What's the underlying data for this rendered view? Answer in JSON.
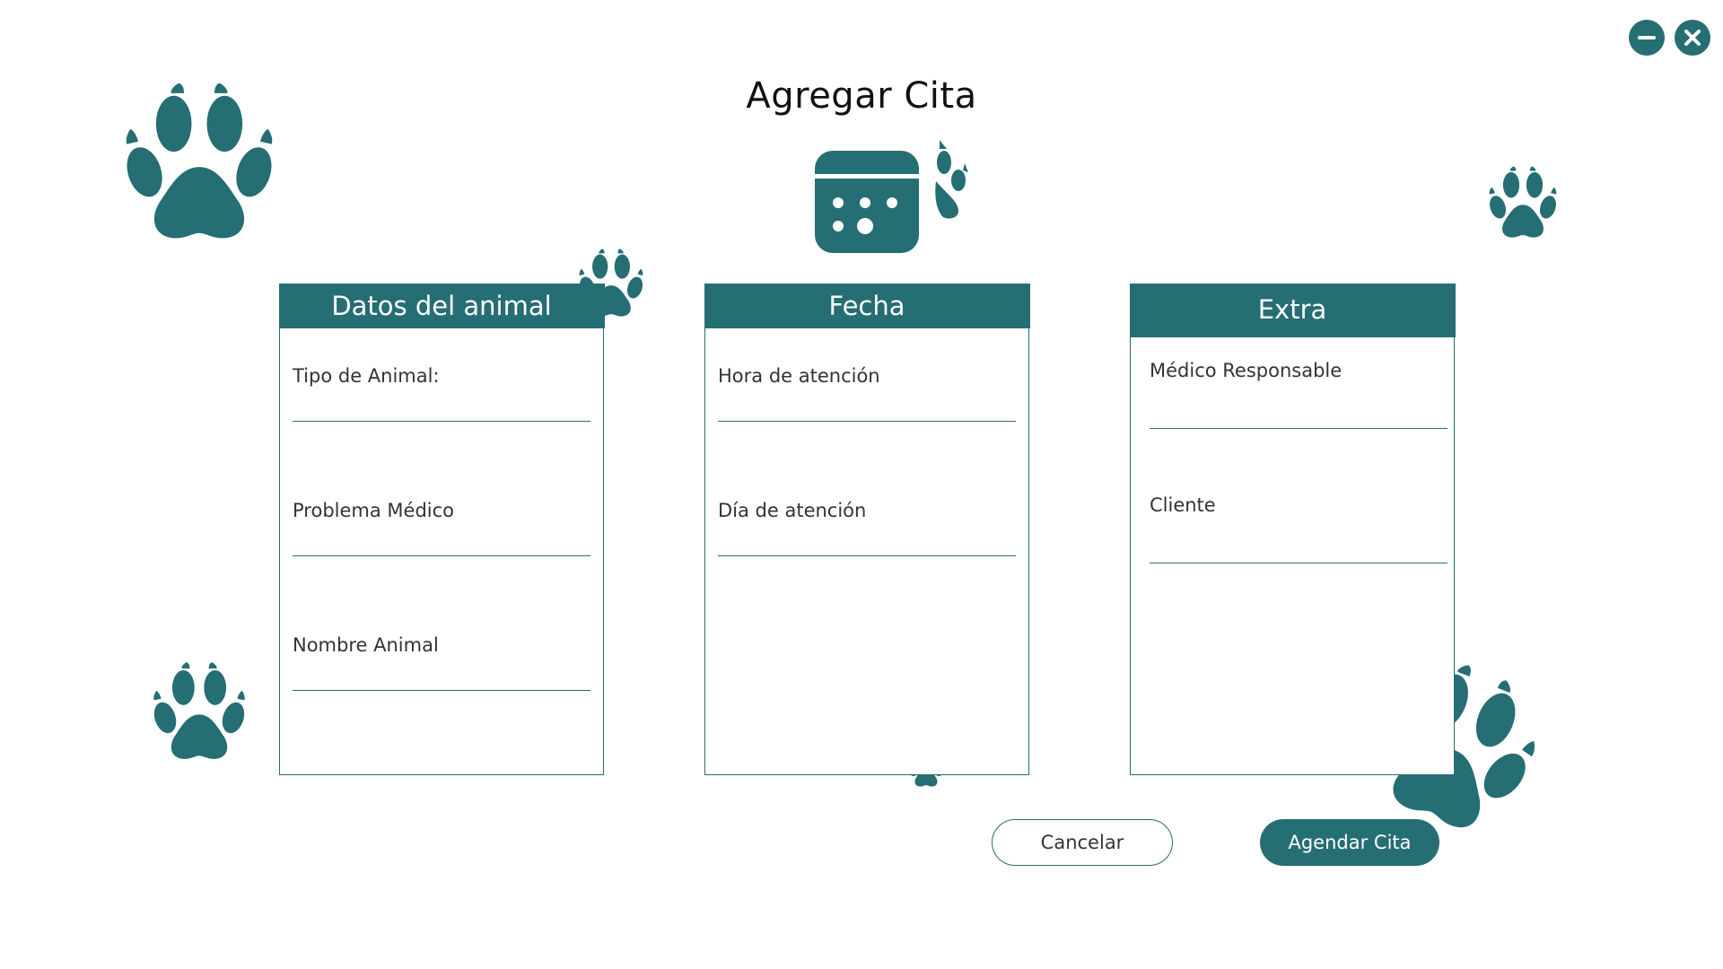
{
  "window": {
    "minimize_icon": "minus-icon",
    "close_icon": "close-x-icon"
  },
  "title": "Agregar Cita",
  "header_icon": "calendar-paw-icon",
  "decorations": {
    "icon": "paw-print-icon",
    "color": "#256e74"
  },
  "panels": {
    "animal": {
      "header": "Datos del animal",
      "fields": [
        {
          "label": "Tipo de Animal:",
          "value": ""
        },
        {
          "label": "Problema Médico",
          "value": ""
        },
        {
          "label": "Nombre Animal",
          "value": ""
        }
      ]
    },
    "fecha": {
      "header": "Fecha",
      "fields": [
        {
          "label": "Hora de atención",
          "value": ""
        },
        {
          "label": "Día de atención",
          "value": ""
        }
      ]
    },
    "extra": {
      "header": "Extra",
      "fields": [
        {
          "label": "Médico Responsable",
          "value": ""
        },
        {
          "label": "Cliente",
          "value": ""
        }
      ]
    }
  },
  "buttons": {
    "cancel": "Cancelar",
    "submit": "Agendar Cita"
  },
  "colors": {
    "accent": "#256e74",
    "background": "#ffffff",
    "text": "#333333"
  }
}
